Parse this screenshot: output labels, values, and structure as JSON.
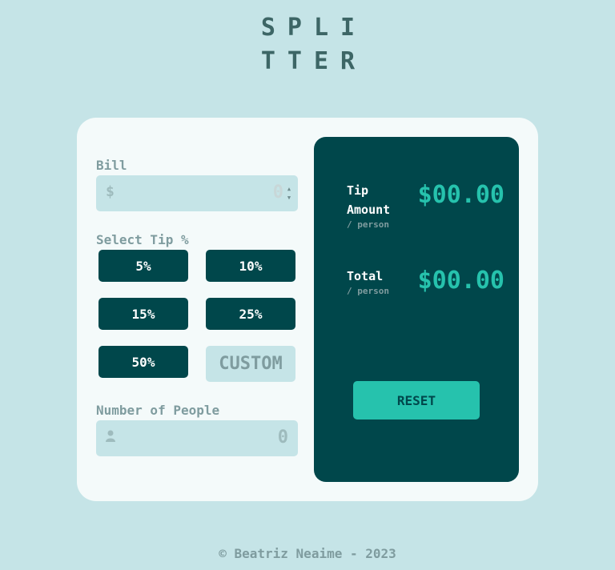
{
  "logo": {
    "line1": "SPLI",
    "line2": "TTER"
  },
  "bill": {
    "label": "Bill",
    "prefix": "$",
    "value": "0"
  },
  "tip": {
    "label": "Select Tip %",
    "options": [
      "5%",
      "10%",
      "15%",
      "25%",
      "50%"
    ],
    "custom_placeholder": "CUSTOM"
  },
  "people": {
    "label": "Number of People",
    "value": "0",
    "icon": "person-icon"
  },
  "results": {
    "tip_label_line1": "Tip",
    "tip_label_line2": "Amount",
    "tip_sub": "/ person",
    "tip_amount": "$00.00",
    "total_label": "Total",
    "total_sub": "/ person",
    "total_amount": "$00.00",
    "reset_label": "RESET"
  },
  "footer": {
    "text": "© Beatriz Neaime - 2023"
  },
  "colors": {
    "background": "#c5e4e7",
    "dark_cyan": "#00474b",
    "accent": "#26c2ad",
    "card": "#f4fafa",
    "muted": "#7f9c9f"
  }
}
